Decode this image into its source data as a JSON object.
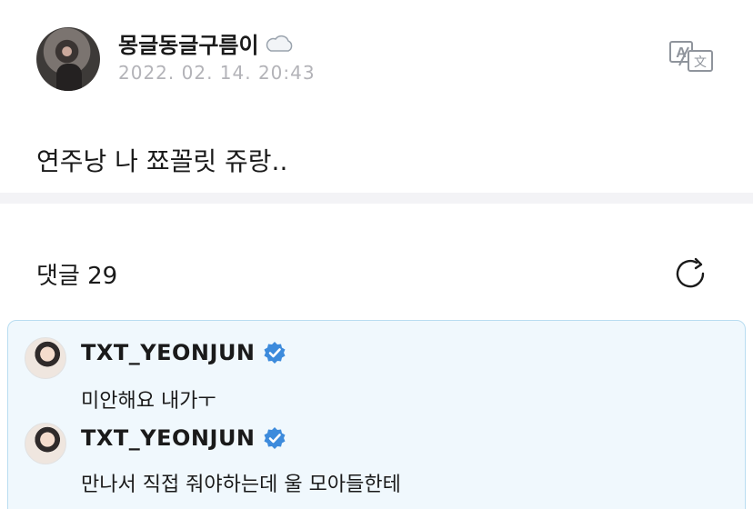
{
  "post": {
    "author": "몽글동글구름이",
    "timestamp": "2022. 02. 14. 20:43",
    "text": "연주낭 나 쬬꼴릿 쥬랑.."
  },
  "icons": {
    "cloud": "cloud-icon",
    "translate": "translate-icon",
    "refresh": "refresh-icon",
    "verified": "verified-badge-icon"
  },
  "colors": {
    "highlight_bg": "#f0f8fd",
    "highlight_border": "#b9ddf1",
    "verified": "#3d8bdc",
    "muted_text": "#b3b3b8"
  },
  "comments": {
    "title": "댓글 29",
    "artist_items": [
      {
        "author": "TXT_YEONJUN",
        "text": "미안해요 내가ㅜ"
      },
      {
        "author": "TXT_YEONJUN",
        "text": "만나서 직접 줘야하는데 울 모아들한테"
      }
    ]
  }
}
